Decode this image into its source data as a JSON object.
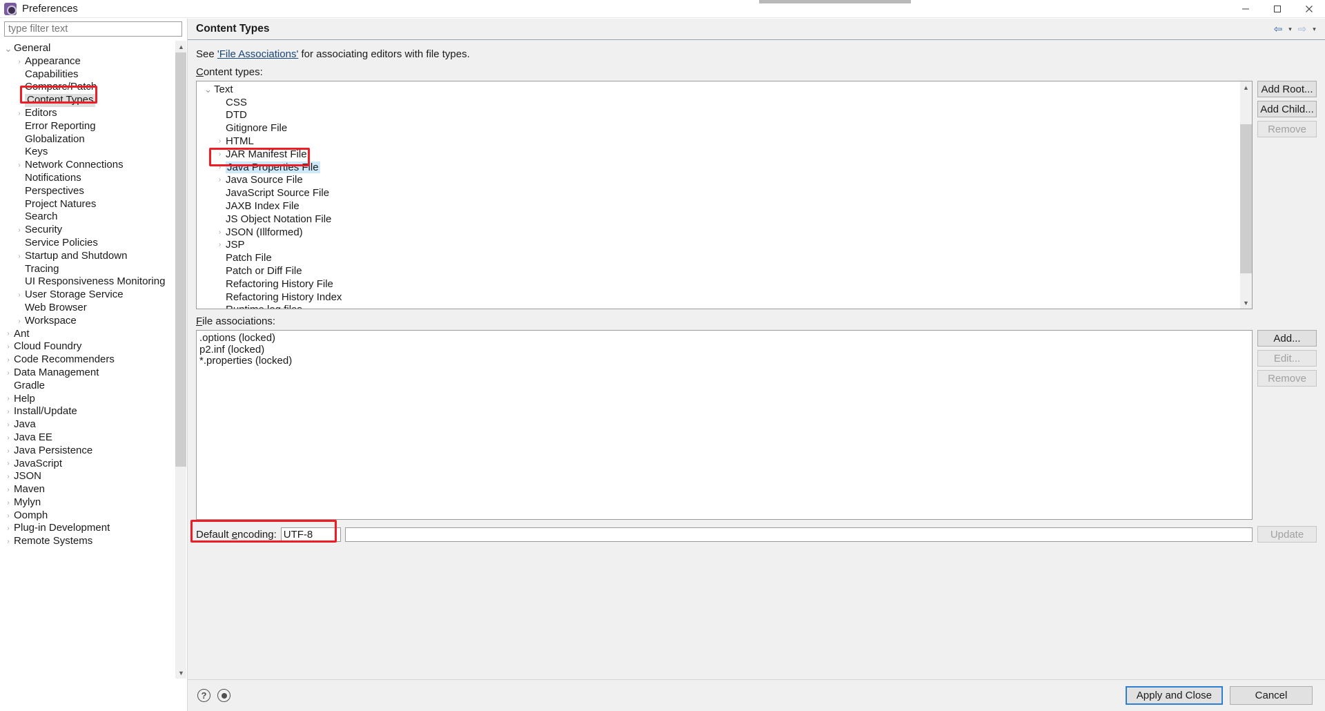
{
  "window": {
    "title": "Preferences",
    "icon": "preferences-icon",
    "minimize": "minimize-icon",
    "maximize": "maximize-icon",
    "close": "close-icon"
  },
  "sidebar": {
    "filter_placeholder": "type filter text",
    "items": [
      {
        "label": "General",
        "level": 0,
        "arrow": "down",
        "selected": false
      },
      {
        "label": "Appearance",
        "level": 1,
        "arrow": "right",
        "selected": false
      },
      {
        "label": "Capabilities",
        "level": 1,
        "arrow": "none",
        "selected": false
      },
      {
        "label": "Compare/Patch",
        "level": 1,
        "arrow": "none",
        "selected": false
      },
      {
        "label": "Content Types",
        "level": 1,
        "arrow": "none",
        "selected": true
      },
      {
        "label": "Editors",
        "level": 1,
        "arrow": "right",
        "selected": false
      },
      {
        "label": "Error Reporting",
        "level": 1,
        "arrow": "none",
        "selected": false
      },
      {
        "label": "Globalization",
        "level": 1,
        "arrow": "none",
        "selected": false
      },
      {
        "label": "Keys",
        "level": 1,
        "arrow": "none",
        "selected": false
      },
      {
        "label": "Network Connections",
        "level": 1,
        "arrow": "right",
        "selected": false
      },
      {
        "label": "Notifications",
        "level": 1,
        "arrow": "none",
        "selected": false
      },
      {
        "label": "Perspectives",
        "level": 1,
        "arrow": "none",
        "selected": false
      },
      {
        "label": "Project Natures",
        "level": 1,
        "arrow": "none",
        "selected": false
      },
      {
        "label": "Search",
        "level": 1,
        "arrow": "none",
        "selected": false
      },
      {
        "label": "Security",
        "level": 1,
        "arrow": "right",
        "selected": false
      },
      {
        "label": "Service Policies",
        "level": 1,
        "arrow": "none",
        "selected": false
      },
      {
        "label": "Startup and Shutdown",
        "level": 1,
        "arrow": "right",
        "selected": false
      },
      {
        "label": "Tracing",
        "level": 1,
        "arrow": "none",
        "selected": false
      },
      {
        "label": "UI Responsiveness Monitoring",
        "level": 1,
        "arrow": "none",
        "selected": false
      },
      {
        "label": "User Storage Service",
        "level": 1,
        "arrow": "right",
        "selected": false
      },
      {
        "label": "Web Browser",
        "level": 1,
        "arrow": "none",
        "selected": false
      },
      {
        "label": "Workspace",
        "level": 1,
        "arrow": "right",
        "selected": false
      },
      {
        "label": "Ant",
        "level": 0,
        "arrow": "right",
        "selected": false
      },
      {
        "label": "Cloud Foundry",
        "level": 0,
        "arrow": "right",
        "selected": false
      },
      {
        "label": "Code Recommenders",
        "level": 0,
        "arrow": "right",
        "selected": false
      },
      {
        "label": "Data Management",
        "level": 0,
        "arrow": "right",
        "selected": false
      },
      {
        "label": "Gradle",
        "level": 0,
        "arrow": "none",
        "selected": false
      },
      {
        "label": "Help",
        "level": 0,
        "arrow": "right",
        "selected": false
      },
      {
        "label": "Install/Update",
        "level": 0,
        "arrow": "right",
        "selected": false
      },
      {
        "label": "Java",
        "level": 0,
        "arrow": "right",
        "selected": false
      },
      {
        "label": "Java EE",
        "level": 0,
        "arrow": "right",
        "selected": false
      },
      {
        "label": "Java Persistence",
        "level": 0,
        "arrow": "right",
        "selected": false
      },
      {
        "label": "JavaScript",
        "level": 0,
        "arrow": "right",
        "selected": false
      },
      {
        "label": "JSON",
        "level": 0,
        "arrow": "right",
        "selected": false
      },
      {
        "label": "Maven",
        "level": 0,
        "arrow": "right",
        "selected": false
      },
      {
        "label": "Mylyn",
        "level": 0,
        "arrow": "right",
        "selected": false
      },
      {
        "label": "Oomph",
        "level": 0,
        "arrow": "right",
        "selected": false
      },
      {
        "label": "Plug-in Development",
        "level": 0,
        "arrow": "right",
        "selected": false
      },
      {
        "label": "Remote Systems",
        "level": 0,
        "arrow": "right",
        "selected": false
      }
    ]
  },
  "page": {
    "title": "Content Types",
    "nav": {
      "back": "back-arrow-icon",
      "back_caret": "chevron-down-icon",
      "forward": "forward-arrow-icon",
      "forward_caret": "chevron-down-icon"
    },
    "see_prefix": "See ",
    "see_link": "'File Associations'",
    "see_suffix": " for associating editors with file types.",
    "content_types_label": "Content types:",
    "file_associations_label": "File associations:",
    "encoding_label": "Default encoding:",
    "encoding_value": "UTF-8"
  },
  "content_types": [
    {
      "label": "Text",
      "level": 0,
      "arrow": "down",
      "selected": false
    },
    {
      "label": "CSS",
      "level": 1,
      "arrow": "none",
      "selected": false
    },
    {
      "label": "DTD",
      "level": 1,
      "arrow": "none",
      "selected": false
    },
    {
      "label": "Gitignore File",
      "level": 1,
      "arrow": "none",
      "selected": false
    },
    {
      "label": "HTML",
      "level": 1,
      "arrow": "right",
      "selected": false
    },
    {
      "label": "JAR Manifest File",
      "level": 1,
      "arrow": "right",
      "selected": false
    },
    {
      "label": "Java Properties File",
      "level": 1,
      "arrow": "right",
      "selected": true
    },
    {
      "label": "Java Source File",
      "level": 1,
      "arrow": "right",
      "selected": false
    },
    {
      "label": "JavaScript Source File",
      "level": 1,
      "arrow": "none",
      "selected": false
    },
    {
      "label": "JAXB Index File",
      "level": 1,
      "arrow": "none",
      "selected": false
    },
    {
      "label": "JS Object Notation File",
      "level": 1,
      "arrow": "none",
      "selected": false
    },
    {
      "label": "JSON (Illformed)",
      "level": 1,
      "arrow": "right",
      "selected": false
    },
    {
      "label": "JSP",
      "level": 1,
      "arrow": "right",
      "selected": false
    },
    {
      "label": "Patch File",
      "level": 1,
      "arrow": "none",
      "selected": false
    },
    {
      "label": "Patch or Diff File",
      "level": 1,
      "arrow": "none",
      "selected": false
    },
    {
      "label": "Refactoring History File",
      "level": 1,
      "arrow": "none",
      "selected": false
    },
    {
      "label": "Refactoring History Index",
      "level": 1,
      "arrow": "none",
      "selected": false
    },
    {
      "label": "Runtime log files",
      "level": 1,
      "arrow": "none",
      "selected": false
    }
  ],
  "content_type_buttons": [
    {
      "label": "Add Root...",
      "disabled": false
    },
    {
      "label": "Add Child...",
      "disabled": false
    },
    {
      "label": "Remove",
      "disabled": true
    }
  ],
  "file_associations": [
    ".options (locked)",
    "p2.inf (locked)",
    "*.properties (locked)"
  ],
  "file_association_buttons": [
    {
      "label": "Add...",
      "disabled": false
    },
    {
      "label": "Edit...",
      "disabled": true
    },
    {
      "label": "Remove",
      "disabled": true
    }
  ],
  "encoding_button": {
    "label": "Update",
    "disabled": true
  },
  "bottom": {
    "help_icon": "help-icon",
    "record_icon": "record-icon",
    "apply_and_close": "Apply and Close",
    "cancel": "Cancel"
  },
  "colors": {
    "annotation": "#ee1c25",
    "selection": "#cde8f9",
    "tree_selection_gray": "#dedede",
    "link": "#17457c",
    "default_button_border": "#2f7fd0"
  }
}
